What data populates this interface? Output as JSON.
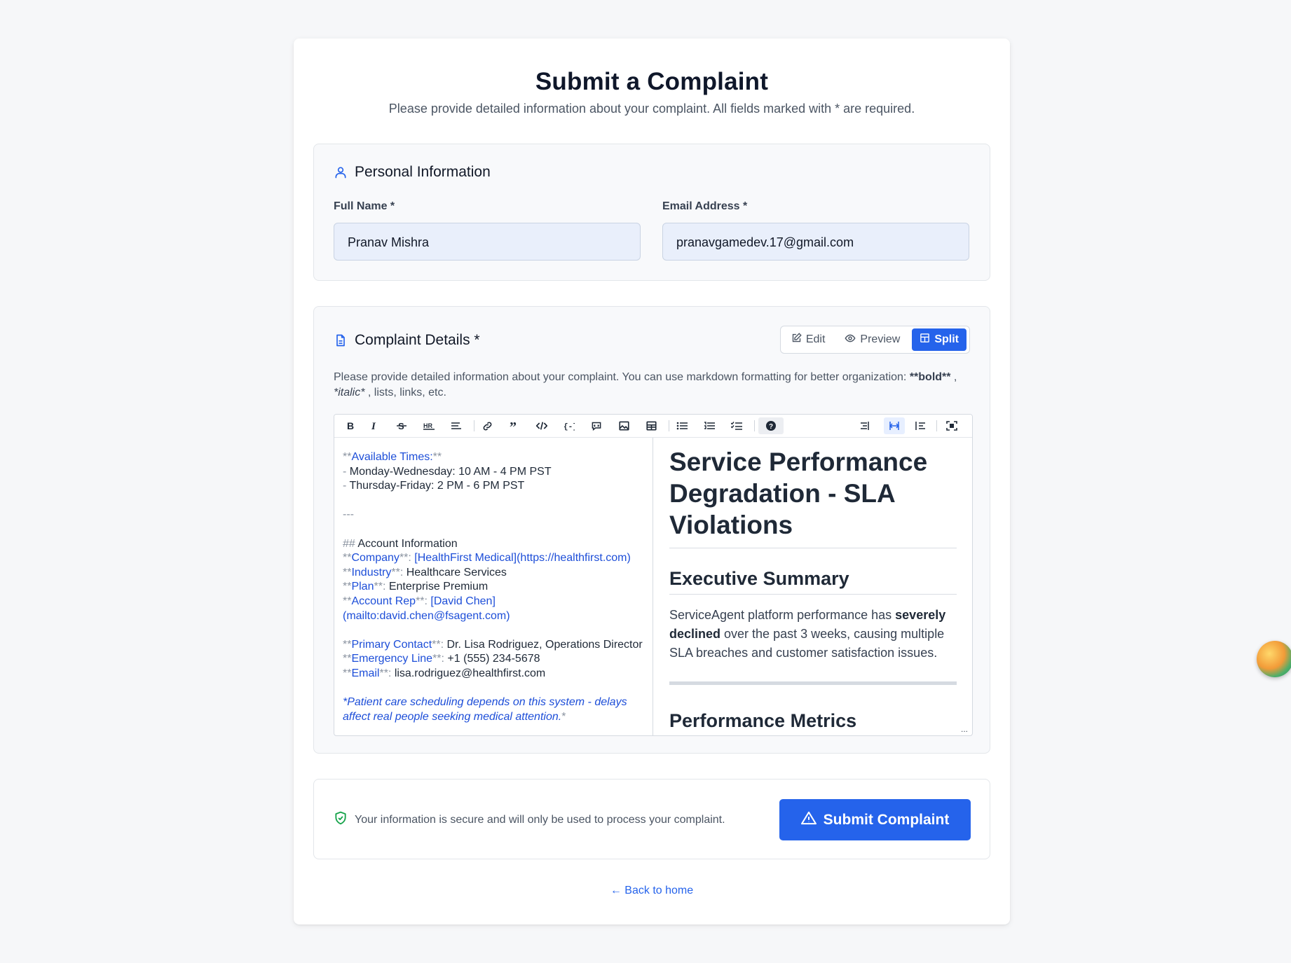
{
  "page": {
    "title": "Submit a Complaint",
    "subtitle": "Please provide detailed information about your complaint. All fields marked with * are required."
  },
  "personal": {
    "heading": "Personal Information",
    "full_name_label": "Full Name *",
    "full_name_value": "Pranav Mishra",
    "email_label": "Email Address *",
    "email_value": "pranavgamedev.17@gmail.com"
  },
  "details": {
    "heading": "Complaint Details *",
    "modes": {
      "edit": "Edit",
      "preview": "Preview",
      "split": "Split",
      "active": "split"
    },
    "hint_prefix": "Please provide detailed information about your complaint. You can use markdown formatting for better organization: ",
    "hint_bold": "**bold**",
    "hint_sep": " ,",
    "hint_italic": "*italic*",
    "hint_suffix": " , lists, links, etc."
  },
  "toolbar": {
    "buttons": [
      "bold-icon",
      "italic-icon",
      "strikethrough-icon",
      "heading-icon",
      "heading-size-icon",
      "link-icon",
      "quote-icon",
      "code-icon",
      "code-block-icon",
      "comment-icon",
      "image-icon",
      "table-icon",
      "unordered-list-icon",
      "ordered-list-icon",
      "checked-list-icon",
      "help-icon",
      "edit-mode-icon",
      "split-mode-icon",
      "preview-mode-icon",
      "fullscreen-icon"
    ]
  },
  "source": {
    "l1_a": "**",
    "l1_b": "Available Times:",
    "l1_c": "**",
    "l2_a": "- ",
    "l2_b": "Monday-Wednesday: 10 AM - 4 PM PST",
    "l3_a": "- ",
    "l3_b": "Thursday-Friday: 2 PM - 6 PM PST",
    "l5": "---",
    "l7_a": "## ",
    "l7_b": "Account Information",
    "l8_a": "**",
    "l8_b": "Company",
    "l8_c": "**: ",
    "l8_d": "[HealthFirst Medical](https://healthfirst.com)",
    "l9_a": "**",
    "l9_b": "Industry",
    "l9_c": "**: ",
    "l9_d": "Healthcare Services",
    "l10_a": "**",
    "l10_b": "Plan",
    "l10_c": "**: ",
    "l10_d": "Enterprise Premium",
    "l11_a": "**",
    "l11_b": "Account Rep",
    "l11_c": "**: ",
    "l11_d": "[David Chen]",
    "l12": "(mailto:david.chen@fsagent.com)",
    "l14_a": "**",
    "l14_b": "Primary Contact",
    "l14_c": "**: ",
    "l14_d": "Dr. Lisa Rodriguez, Operations Director",
    "l15_a": "**",
    "l15_b": "Emergency Line",
    "l15_c": "**: ",
    "l15_d": "+1 (555) 234-5678",
    "l16_a": "**",
    "l16_b": "Email",
    "l16_c": "**: ",
    "l16_d": "lisa.rodriguez@healthfirst.com",
    "l18": "*Patient care scheduling depends on this system - delays",
    "l19_a": "affect real people seeking medical attention.",
    "l19_b": "*"
  },
  "preview": {
    "h1": "Service Performance Degradation - SLA Violations",
    "h2": "Executive Summary",
    "p_a": "ServiceAgent platform performance has ",
    "p_b": "severely declined",
    "p_c": " over the past 3 weeks, causing multiple SLA breaches and customer satisfaction issues.",
    "h2b": "Performance Metrics",
    "more": "..."
  },
  "footer": {
    "secure_text": "Your information is secure and will only be used to process your complaint.",
    "submit_label": "Submit Complaint",
    "back_link": "← Back to home"
  },
  "colors": {
    "accent": "#2563eb",
    "secure": "#16a34a"
  }
}
